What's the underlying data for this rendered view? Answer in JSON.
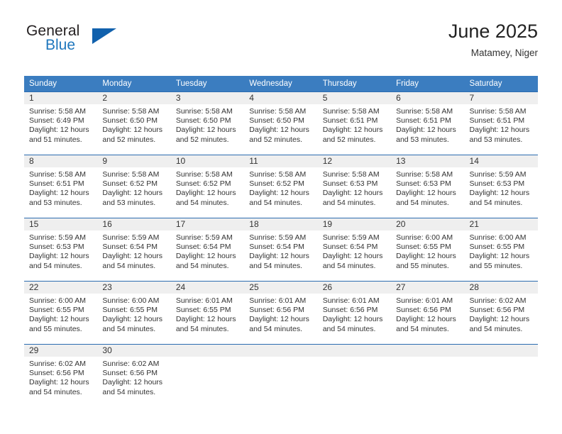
{
  "brand": {
    "name_top": "General",
    "name_bottom": "Blue",
    "accent_color": "#1161ad",
    "text_color": "#231f20"
  },
  "header": {
    "title": "June 2025",
    "subtitle": "Matamey, Niger"
  },
  "theme": {
    "header_bg": "#3b7dc0",
    "row_divider": "#2b6cb0",
    "daynum_bg": "#efefef",
    "text": "#333333"
  },
  "weekday_headers": [
    "Sunday",
    "Monday",
    "Tuesday",
    "Wednesday",
    "Thursday",
    "Friday",
    "Saturday"
  ],
  "weeks": [
    [
      {
        "day": "1",
        "sunrise": "Sunrise: 5:58 AM",
        "sunset": "Sunset: 6:49 PM",
        "daylight_line1": "Daylight: 12 hours",
        "daylight_line2": "and 51 minutes."
      },
      {
        "day": "2",
        "sunrise": "Sunrise: 5:58 AM",
        "sunset": "Sunset: 6:50 PM",
        "daylight_line1": "Daylight: 12 hours",
        "daylight_line2": "and 52 minutes."
      },
      {
        "day": "3",
        "sunrise": "Sunrise: 5:58 AM",
        "sunset": "Sunset: 6:50 PM",
        "daylight_line1": "Daylight: 12 hours",
        "daylight_line2": "and 52 minutes."
      },
      {
        "day": "4",
        "sunrise": "Sunrise: 5:58 AM",
        "sunset": "Sunset: 6:50 PM",
        "daylight_line1": "Daylight: 12 hours",
        "daylight_line2": "and 52 minutes."
      },
      {
        "day": "5",
        "sunrise": "Sunrise: 5:58 AM",
        "sunset": "Sunset: 6:51 PM",
        "daylight_line1": "Daylight: 12 hours",
        "daylight_line2": "and 52 minutes."
      },
      {
        "day": "6",
        "sunrise": "Sunrise: 5:58 AM",
        "sunset": "Sunset: 6:51 PM",
        "daylight_line1": "Daylight: 12 hours",
        "daylight_line2": "and 53 minutes."
      },
      {
        "day": "7",
        "sunrise": "Sunrise: 5:58 AM",
        "sunset": "Sunset: 6:51 PM",
        "daylight_line1": "Daylight: 12 hours",
        "daylight_line2": "and 53 minutes."
      }
    ],
    [
      {
        "day": "8",
        "sunrise": "Sunrise: 5:58 AM",
        "sunset": "Sunset: 6:51 PM",
        "daylight_line1": "Daylight: 12 hours",
        "daylight_line2": "and 53 minutes."
      },
      {
        "day": "9",
        "sunrise": "Sunrise: 5:58 AM",
        "sunset": "Sunset: 6:52 PM",
        "daylight_line1": "Daylight: 12 hours",
        "daylight_line2": "and 53 minutes."
      },
      {
        "day": "10",
        "sunrise": "Sunrise: 5:58 AM",
        "sunset": "Sunset: 6:52 PM",
        "daylight_line1": "Daylight: 12 hours",
        "daylight_line2": "and 54 minutes."
      },
      {
        "day": "11",
        "sunrise": "Sunrise: 5:58 AM",
        "sunset": "Sunset: 6:52 PM",
        "daylight_line1": "Daylight: 12 hours",
        "daylight_line2": "and 54 minutes."
      },
      {
        "day": "12",
        "sunrise": "Sunrise: 5:58 AM",
        "sunset": "Sunset: 6:53 PM",
        "daylight_line1": "Daylight: 12 hours",
        "daylight_line2": "and 54 minutes."
      },
      {
        "day": "13",
        "sunrise": "Sunrise: 5:58 AM",
        "sunset": "Sunset: 6:53 PM",
        "daylight_line1": "Daylight: 12 hours",
        "daylight_line2": "and 54 minutes."
      },
      {
        "day": "14",
        "sunrise": "Sunrise: 5:59 AM",
        "sunset": "Sunset: 6:53 PM",
        "daylight_line1": "Daylight: 12 hours",
        "daylight_line2": "and 54 minutes."
      }
    ],
    [
      {
        "day": "15",
        "sunrise": "Sunrise: 5:59 AM",
        "sunset": "Sunset: 6:53 PM",
        "daylight_line1": "Daylight: 12 hours",
        "daylight_line2": "and 54 minutes."
      },
      {
        "day": "16",
        "sunrise": "Sunrise: 5:59 AM",
        "sunset": "Sunset: 6:54 PM",
        "daylight_line1": "Daylight: 12 hours",
        "daylight_line2": "and 54 minutes."
      },
      {
        "day": "17",
        "sunrise": "Sunrise: 5:59 AM",
        "sunset": "Sunset: 6:54 PM",
        "daylight_line1": "Daylight: 12 hours",
        "daylight_line2": "and 54 minutes."
      },
      {
        "day": "18",
        "sunrise": "Sunrise: 5:59 AM",
        "sunset": "Sunset: 6:54 PM",
        "daylight_line1": "Daylight: 12 hours",
        "daylight_line2": "and 54 minutes."
      },
      {
        "day": "19",
        "sunrise": "Sunrise: 5:59 AM",
        "sunset": "Sunset: 6:54 PM",
        "daylight_line1": "Daylight: 12 hours",
        "daylight_line2": "and 54 minutes."
      },
      {
        "day": "20",
        "sunrise": "Sunrise: 6:00 AM",
        "sunset": "Sunset: 6:55 PM",
        "daylight_line1": "Daylight: 12 hours",
        "daylight_line2": "and 55 minutes."
      },
      {
        "day": "21",
        "sunrise": "Sunrise: 6:00 AM",
        "sunset": "Sunset: 6:55 PM",
        "daylight_line1": "Daylight: 12 hours",
        "daylight_line2": "and 55 minutes."
      }
    ],
    [
      {
        "day": "22",
        "sunrise": "Sunrise: 6:00 AM",
        "sunset": "Sunset: 6:55 PM",
        "daylight_line1": "Daylight: 12 hours",
        "daylight_line2": "and 55 minutes."
      },
      {
        "day": "23",
        "sunrise": "Sunrise: 6:00 AM",
        "sunset": "Sunset: 6:55 PM",
        "daylight_line1": "Daylight: 12 hours",
        "daylight_line2": "and 54 minutes."
      },
      {
        "day": "24",
        "sunrise": "Sunrise: 6:01 AM",
        "sunset": "Sunset: 6:55 PM",
        "daylight_line1": "Daylight: 12 hours",
        "daylight_line2": "and 54 minutes."
      },
      {
        "day": "25",
        "sunrise": "Sunrise: 6:01 AM",
        "sunset": "Sunset: 6:56 PM",
        "daylight_line1": "Daylight: 12 hours",
        "daylight_line2": "and 54 minutes."
      },
      {
        "day": "26",
        "sunrise": "Sunrise: 6:01 AM",
        "sunset": "Sunset: 6:56 PM",
        "daylight_line1": "Daylight: 12 hours",
        "daylight_line2": "and 54 minutes."
      },
      {
        "day": "27",
        "sunrise": "Sunrise: 6:01 AM",
        "sunset": "Sunset: 6:56 PM",
        "daylight_line1": "Daylight: 12 hours",
        "daylight_line2": "and 54 minutes."
      },
      {
        "day": "28",
        "sunrise": "Sunrise: 6:02 AM",
        "sunset": "Sunset: 6:56 PM",
        "daylight_line1": "Daylight: 12 hours",
        "daylight_line2": "and 54 minutes."
      }
    ],
    [
      {
        "day": "29",
        "sunrise": "Sunrise: 6:02 AM",
        "sunset": "Sunset: 6:56 PM",
        "daylight_line1": "Daylight: 12 hours",
        "daylight_line2": "and 54 minutes."
      },
      {
        "day": "30",
        "sunrise": "Sunrise: 6:02 AM",
        "sunset": "Sunset: 6:56 PM",
        "daylight_line1": "Daylight: 12 hours",
        "daylight_line2": "and 54 minutes."
      },
      {
        "day": "",
        "sunrise": "",
        "sunset": "",
        "daylight_line1": "",
        "daylight_line2": ""
      },
      {
        "day": "",
        "sunrise": "",
        "sunset": "",
        "daylight_line1": "",
        "daylight_line2": ""
      },
      {
        "day": "",
        "sunrise": "",
        "sunset": "",
        "daylight_line1": "",
        "daylight_line2": ""
      },
      {
        "day": "",
        "sunrise": "",
        "sunset": "",
        "daylight_line1": "",
        "daylight_line2": ""
      },
      {
        "day": "",
        "sunrise": "",
        "sunset": "",
        "daylight_line1": "",
        "daylight_line2": ""
      }
    ]
  ]
}
